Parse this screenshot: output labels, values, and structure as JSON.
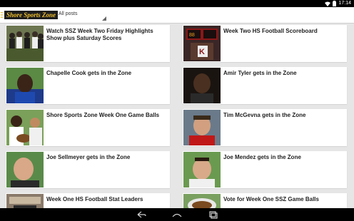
{
  "status_bar": {
    "time": "17:14"
  },
  "action_bar": {
    "app_name": "Shore Sports Zone",
    "filter_selected": "All posts"
  },
  "posts": [
    {
      "title": "Watch SSZ Week Two Friday Highlights Show plus Saturday Scores"
    },
    {
      "title": "Week Two HS Football Scoreboard"
    },
    {
      "title": "Chapelle Cook gets in the Zone"
    },
    {
      "title": "Amir Tyler gets in the Zone"
    },
    {
      "title": "Shore Sports Zone Week One Game Balls"
    },
    {
      "title": "Tim McGevna gets in the Zone"
    },
    {
      "title": "Joe Sellmeyer gets in the Zone"
    },
    {
      "title": "Joe Mendez gets in the Zone"
    },
    {
      "title": "Week One HS Football Stat Leaders"
    },
    {
      "title": "Vote for Week One SSZ Game Balls"
    }
  ],
  "colors": {
    "action_bar": "#ffffff",
    "logo_bg": "#1d1d1d",
    "logo_text": "#f2c12e",
    "background": "#e6e6e6"
  },
  "nav": [
    "back-icon",
    "home-icon",
    "recents-icon"
  ]
}
